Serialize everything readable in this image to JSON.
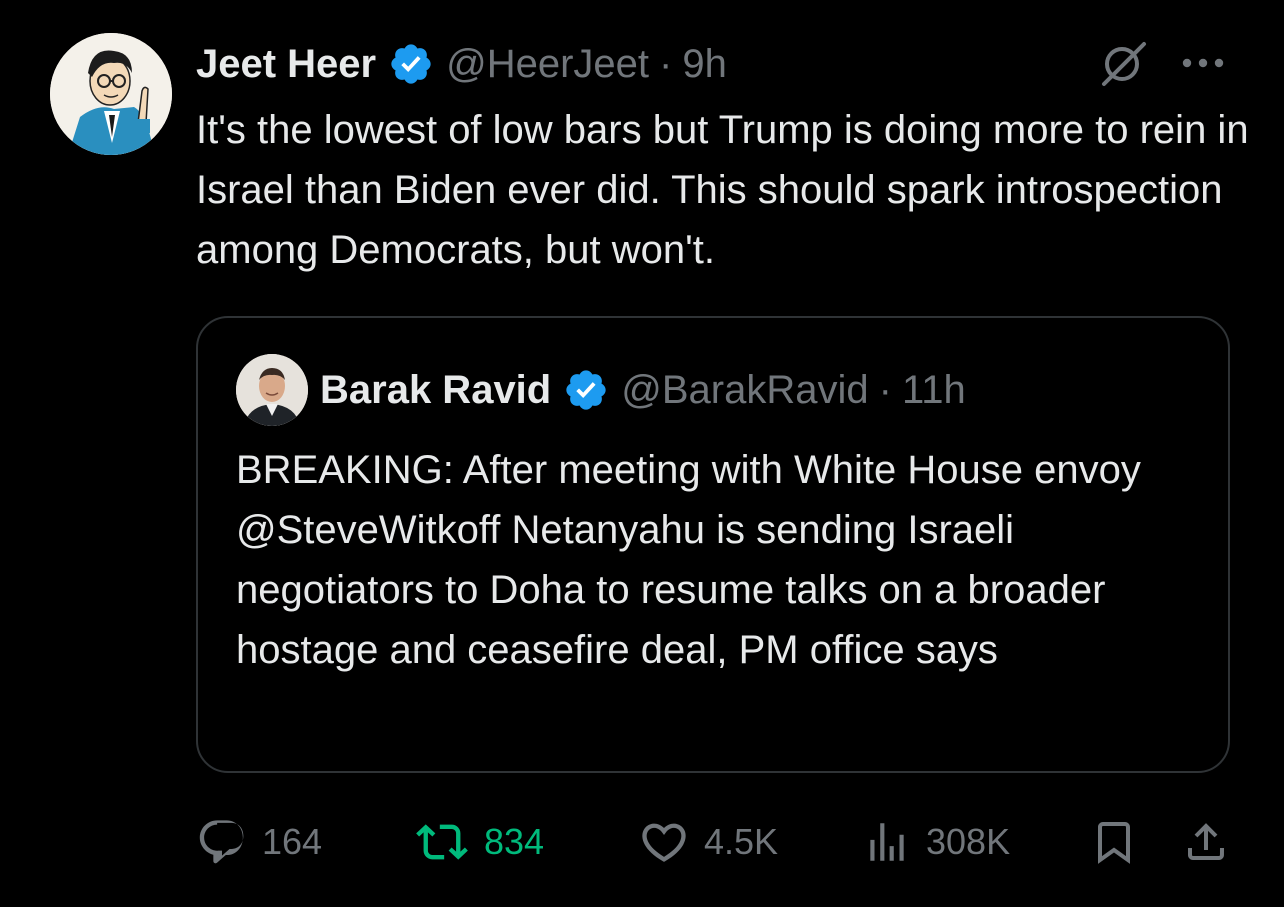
{
  "tweet": {
    "author": {
      "display_name": "Jeet Heer",
      "handle": "@HeerJeet",
      "verified": true,
      "avatar_icon": "caricature-avatar"
    },
    "separator": "·",
    "time": "9h",
    "text": "It's the lowest of low bars but Trump is doing more to rein in Israel than Biden ever did. This should spark introspection among Democrats, but won't.",
    "grok_icon": "grok-icon",
    "more_icon": "more-options-icon"
  },
  "quoted_tweet": {
    "author": {
      "display_name": "Barak Ravid",
      "handle": "@BarakRavid",
      "verified": true,
      "avatar_icon": "profile-photo-avatar"
    },
    "separator": "·",
    "time": "11h",
    "text": "BREAKING: After meeting with White House envoy @SteveWitkoff Netanyahu is sending Israeli negotiators to Doha to resume talks on a broader hostage and ceasefire deal, PM office says"
  },
  "actions": {
    "reply": {
      "icon": "reply-icon",
      "count": "164"
    },
    "retweet": {
      "icon": "retweet-icon",
      "count": "834",
      "active": true
    },
    "like": {
      "icon": "heart-icon",
      "count": "4.5K"
    },
    "views": {
      "icon": "views-icon",
      "count": "308K"
    },
    "bookmark": {
      "icon": "bookmark-icon"
    },
    "share": {
      "icon": "share-icon"
    }
  },
  "colors": {
    "background": "#000000",
    "text_primary": "#e7e9ea",
    "text_secondary": "#71767b",
    "verified_blue": "#1d9bf0",
    "retweet_green": "#00ba7c",
    "border": "#2f3336"
  }
}
